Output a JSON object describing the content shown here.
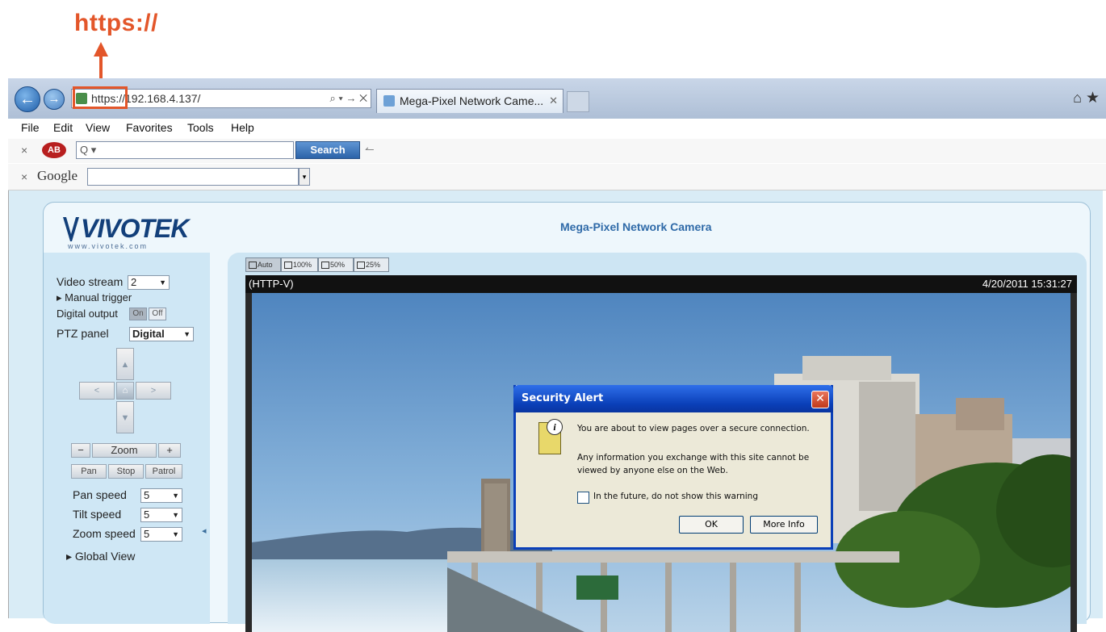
{
  "annotation": {
    "label": "https://",
    "color": "#e3562a"
  },
  "browser": {
    "address_url": "https://192.168.4.137/",
    "address_controls": "⌕ ▾ → ✕",
    "tab_label": "Mega-Pixel Network Came...",
    "tab_close": "✕",
    "back_icon": "back-arrow-icon",
    "forward_icon": "forward-arrow-icon",
    "home_icon": "home-icon",
    "favorites_icon": "star-icon"
  },
  "menu": [
    "File",
    "Edit",
    "View",
    "Favorites",
    "Tools",
    "Help"
  ],
  "toolbar1": {
    "close": "×",
    "logo": "AB",
    "search_placeholder": "Q ▾",
    "search_button": "Search",
    "sep": "↼"
  },
  "toolbar2": {
    "close": "×",
    "logo": "Google",
    "dropdown": "▾"
  },
  "camera_page": {
    "logo": "VIVOTEK",
    "logo_sub": "www.vivotek.com",
    "title": "Mega-Pixel Network Camera",
    "left_panel": {
      "video_stream_label": "Video stream",
      "video_stream_value": "2",
      "manual_trigger_label": "▸ Manual trigger",
      "digital_output_label": "Digital output",
      "digital_output_on": "On",
      "digital_output_off": "Off",
      "ptz_panel_label": "PTZ panel",
      "ptz_panel_value": "Digital",
      "ptz_up": "▲",
      "ptz_down": "▼",
      "ptz_left": "<",
      "ptz_right": ">",
      "ptz_home": "⌂",
      "zoom_minus": "−",
      "zoom_label": "Zoom",
      "zoom_plus": "+",
      "pan_button": "Pan",
      "stop_button": "Stop",
      "patrol_button": "Patrol",
      "pan_speed_label": "Pan speed",
      "pan_speed_value": "5",
      "tilt_speed_label": "Tilt speed",
      "tilt_speed_value": "5",
      "zoom_speed_label": "Zoom speed",
      "zoom_speed_value": "5",
      "global_view_label": "▸ Global View",
      "collapse_arrow": "◂",
      "dropdown_arrow": "▼"
    },
    "resolution_buttons": [
      "Auto",
      "100%",
      "50%",
      "25%"
    ],
    "video": {
      "protocol": "(HTTP-V)",
      "timestamp": "4/20/2011 15:31:27"
    }
  },
  "dialog": {
    "title": "Security Alert",
    "close": "✕",
    "info_glyph": "i",
    "message1": "You are about to view pages over a secure connection.",
    "message2": "Any information you exchange with this site cannot be viewed by anyone else on the Web.",
    "checkbox_label": "In the future, do not show this warning",
    "ok_button": "OK",
    "more_info_button": "More Info"
  }
}
